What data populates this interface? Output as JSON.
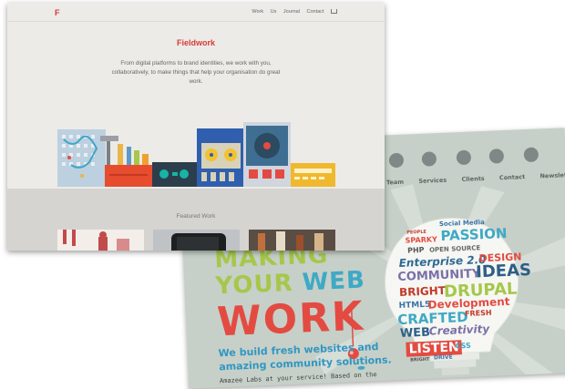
{
  "back_site": {
    "nav": [
      "Team",
      "Services",
      "Clients",
      "Contact",
      "Newsletter"
    ],
    "nav_icons": [
      "team-icon",
      "services-icon",
      "clients-icon",
      "contact-icon",
      "newsletter-icon"
    ],
    "headline_line1": "MAKING",
    "headline_line2_a": "YOUR ",
    "headline_line2_b": "WEB",
    "headline_line3": "WORK",
    "tagline": "We build fresh websites and amazing community solutions.",
    "fineprint": "Amazee Labs at your service! Based on the",
    "cloud": {
      "social_media": "Social Media",
      "people": "PEOPLE",
      "sparky": "SPARKY",
      "passion": "PASSION",
      "php": "PHP",
      "open_source": "OPEN SOURCE",
      "enterprise": "Enterprise 2.0",
      "design": "DESIGN",
      "community": "COMMUNITY",
      "ideas": "IDEAS",
      "bright": "BRIGHT",
      "drupal": "DRUPAL",
      "html5": "HTML5",
      "development": "Development",
      "crafted": "CRAFTED",
      "fresh": "FRESH",
      "web": "WEB",
      "creativity": "Creativity",
      "listen": "LISTEN",
      "bright2": "BRIGHT",
      "drive": "DRIVE",
      "css": "CSS"
    },
    "colors": {
      "background": "#c6d0c8",
      "green": "#a6c74b",
      "blue": "#3fa9c6",
      "red": "#e34b42"
    }
  },
  "front_site": {
    "logo": "F",
    "menu": [
      "Work",
      "Us",
      "Journal",
      "Contact"
    ],
    "cart_icon": "cart-icon",
    "brand": "Fieldwork",
    "intro": "From digital platforms to brand identities, we work with you, collaboratively, to make things that help your organisation do great work.",
    "featured_title": "Featured Work",
    "colors": {
      "accent": "#d93a35",
      "background": "#ecebe7",
      "featured_bg": "#d5d4d0"
    }
  }
}
